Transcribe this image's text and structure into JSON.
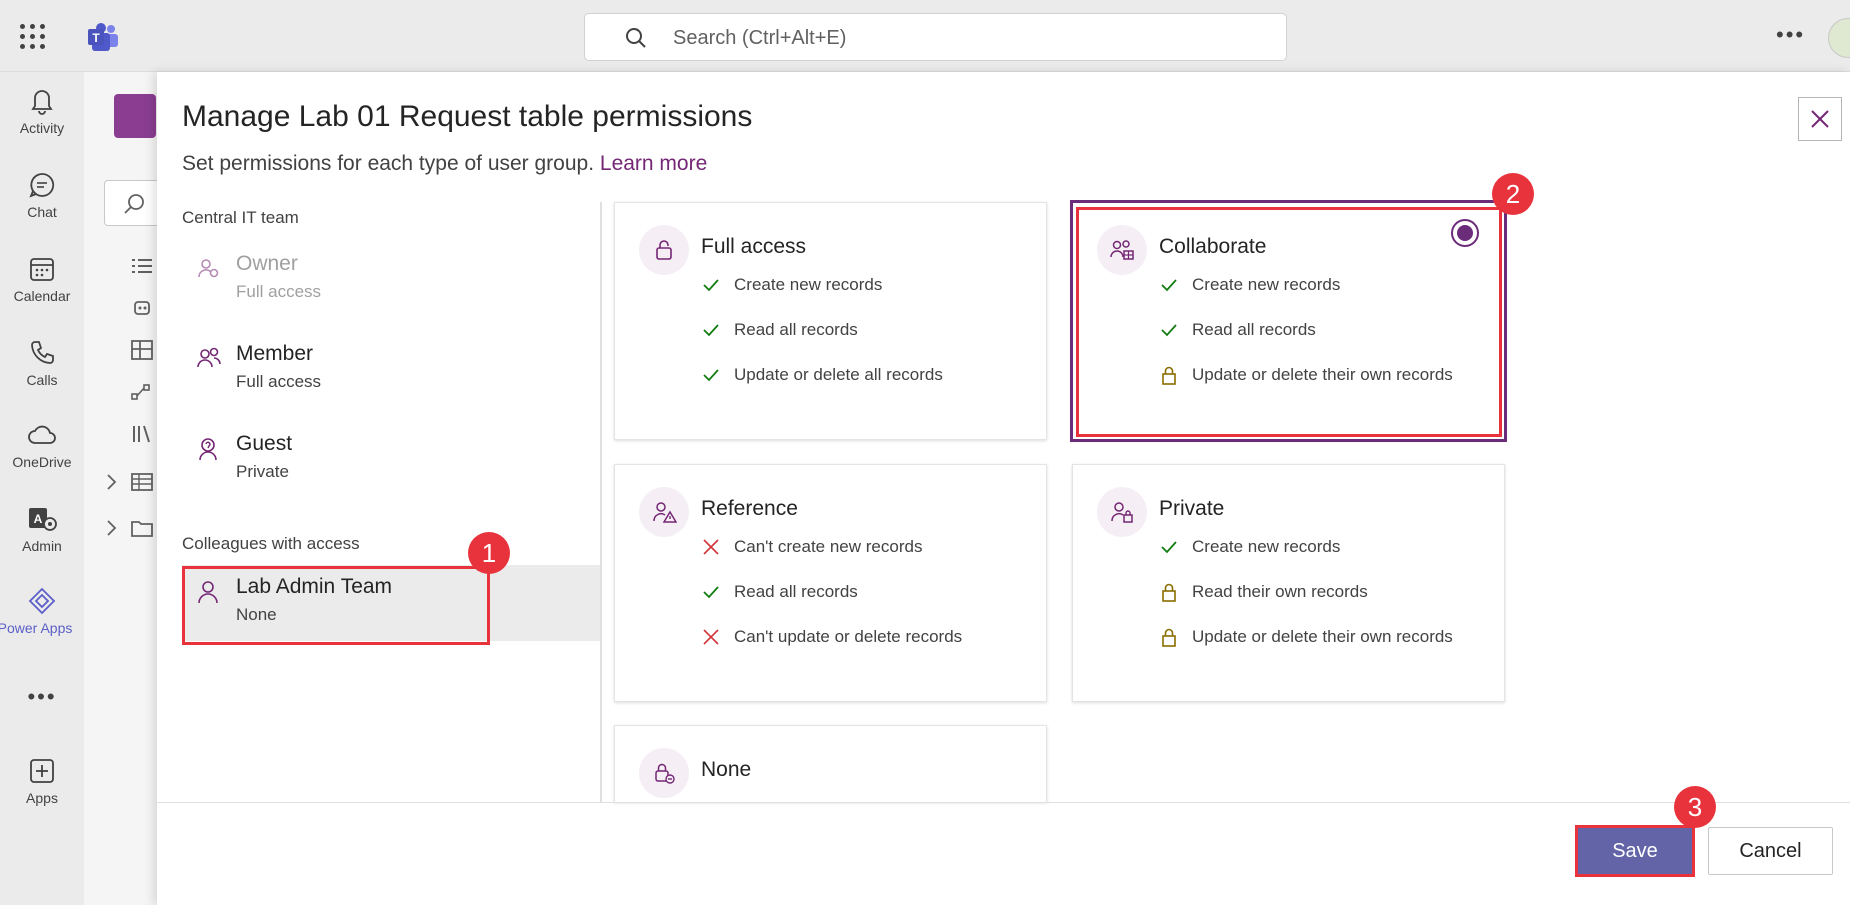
{
  "search": {
    "placeholder": "Search (Ctrl+Alt+E)"
  },
  "rail": [
    {
      "label": "Activity",
      "icon": "bell-icon"
    },
    {
      "label": "Chat",
      "icon": "chat-icon"
    },
    {
      "label": "Calendar",
      "icon": "calendar-icon"
    },
    {
      "label": "Calls",
      "icon": "phone-icon"
    },
    {
      "label": "OneDrive",
      "icon": "cloud-icon"
    },
    {
      "label": "Admin",
      "icon": "admin-icon"
    },
    {
      "label": "Power Apps",
      "icon": "power-apps-icon"
    },
    {
      "label": "Apps",
      "icon": "add-apps-icon"
    }
  ],
  "dialog": {
    "title": "Manage Lab 01 Request table permissions",
    "subtitle": "Set permissions for each type of user group.",
    "learn_more": "Learn more",
    "group_central": "Central IT team",
    "group_colleagues": "Colleagues with access",
    "roles": [
      {
        "name": "Owner",
        "access": "Full access"
      },
      {
        "name": "Member",
        "access": "Full access"
      },
      {
        "name": "Guest",
        "access": "Private"
      },
      {
        "name": "Lab Admin Team",
        "access": "None"
      }
    ],
    "cards": [
      {
        "name": "Full access",
        "perms": [
          "Create new records",
          "Read all records",
          "Update or delete all records"
        ]
      },
      {
        "name": "Collaborate",
        "perms": [
          "Create new records",
          "Read all records",
          "Update or delete their own records"
        ]
      },
      {
        "name": "Reference",
        "perms": [
          "Can't create new records",
          "Read all records",
          "Can't update or delete records"
        ]
      },
      {
        "name": "Private",
        "perms": [
          "Create new records",
          "Read their own records",
          "Update or delete their own records"
        ]
      },
      {
        "name": "None"
      }
    ],
    "save_label": "Save",
    "cancel_label": "Cancel"
  },
  "annotations": [
    "1",
    "2",
    "3"
  ],
  "colors": {
    "accent": "#6b2c7a",
    "teams_purple": "#6264a7",
    "highlight": "#e8323c",
    "check": "#107c10",
    "lock": "#8a6d00",
    "cross": "#d13438"
  }
}
